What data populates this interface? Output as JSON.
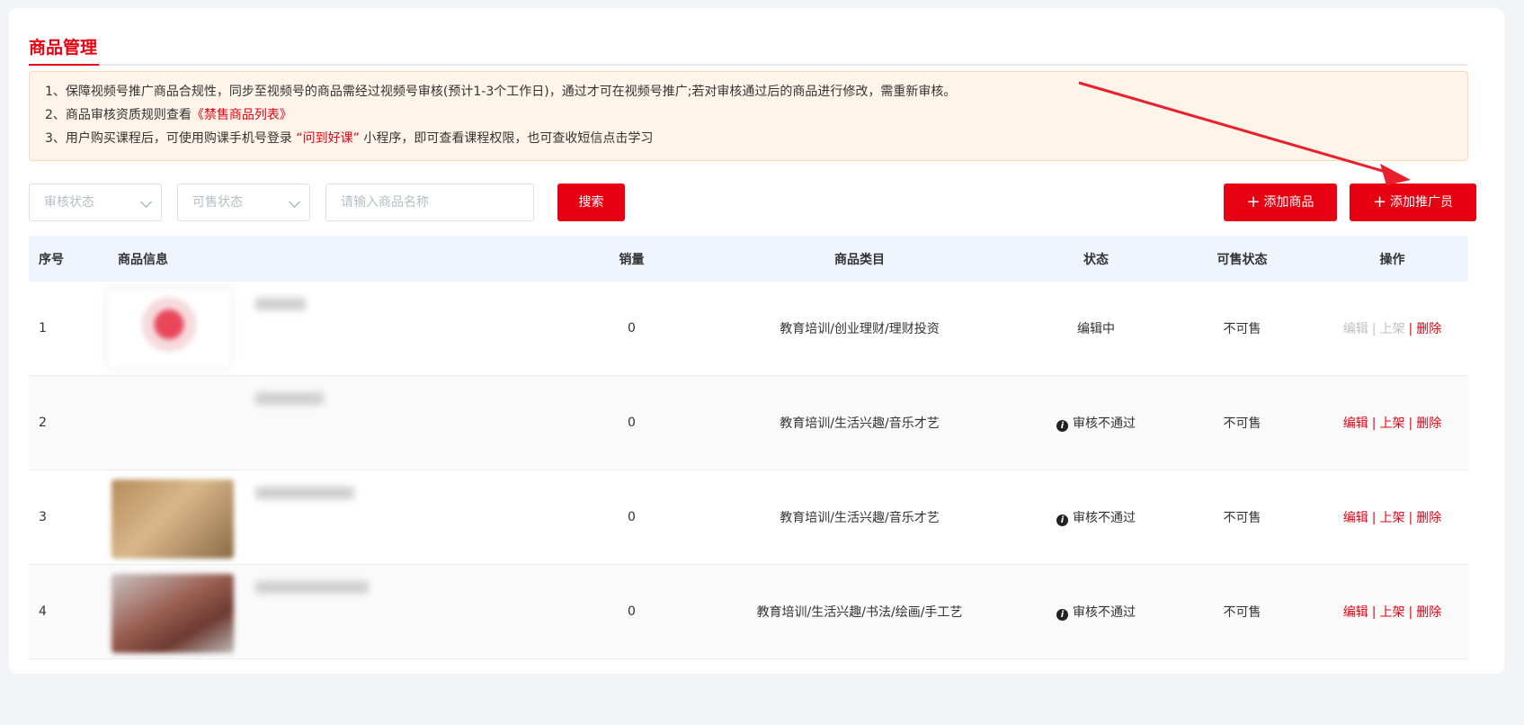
{
  "page": {
    "tab_title": "商品管理"
  },
  "notice": {
    "line1": "1、保障视频号推广商品合规性，同步至视频号的商品需经过视频号审核(预计1-3个工作日)，通过才可在视频号推广;若对审核通过后的商品进行修改，需重新审核。",
    "line2_prefix": "2、商品审核资质规则查看",
    "line2_link": "《禁售商品列表》",
    "line3_prefix": "3、用户购买课程后，可使用购课手机号登录 ",
    "line3_highlight": "“问到好课”",
    "line3_suffix": " 小程序，即可查看课程权限，也可查收短信点击学习"
  },
  "filters": {
    "audit_status_placeholder": "审核状态",
    "sale_status_placeholder": "可售状态",
    "search_placeholder": "请输入商品名称",
    "search_button": "搜索",
    "add_product_button": "添加商品",
    "add_promoter_button": "添加推广员"
  },
  "table": {
    "headers": [
      "序号",
      "商品信息",
      "销量",
      "商品类目",
      "状态",
      "可售状态",
      "操作"
    ],
    "rows": [
      {
        "index": "1",
        "sales": "0",
        "category": "教育培训/创业理财/理财投资",
        "status": "编辑中",
        "status_icon": "",
        "sale_status": "不可售"
      },
      {
        "index": "2",
        "sales": "0",
        "category": "教育培训/生活兴趣/音乐才艺",
        "status": "审核不通过",
        "status_icon": "info-icon",
        "sale_status": "不可售"
      },
      {
        "index": "3",
        "sales": "0",
        "category": "教育培训/生活兴趣/音乐才艺",
        "status": "审核不通过",
        "status_icon": "info-icon",
        "sale_status": "不可售"
      },
      {
        "index": "4",
        "sales": "0",
        "category": "教育培训/生活兴趣/书法/绘画/手工艺",
        "status": "审核不通过",
        "status_icon": "info-icon",
        "sale_status": "不可售"
      }
    ],
    "ops": {
      "edit": "编辑",
      "shelve": "上架",
      "delete": "删除",
      "sep": "|"
    }
  },
  "colors": {
    "accent": "#e60012",
    "notice_bg": "#fef4ea",
    "header_bg": "#eef5fd"
  }
}
